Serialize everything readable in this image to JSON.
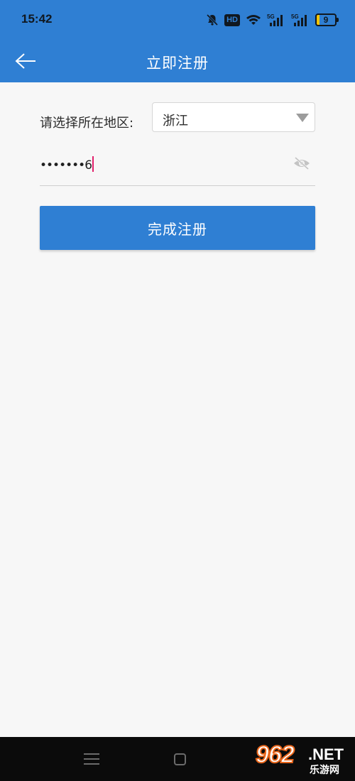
{
  "status_bar": {
    "time": "15:42",
    "hd_label": "HD",
    "signal_label_1": "5G",
    "signal_label_2": "5G",
    "battery_level": "9"
  },
  "app_bar": {
    "title": "立即注册",
    "back_icon": "arrow-left-icon"
  },
  "form": {
    "region_label": "请选择所在地区:",
    "region_value": "浙江",
    "password_value": "•••••••6",
    "password_toggle_icon": "eye-off-icon",
    "submit_label": "完成注册"
  },
  "nav_bar": {
    "menu_icon": "menu-icon",
    "home_icon": "home-square-icon"
  },
  "watermark": {
    "number": "962",
    "suffix": ".NET",
    "site": "乐游网"
  },
  "colors": {
    "primary": "#2f7fd3",
    "background": "#f7f7f7",
    "caret": "#e2206b"
  }
}
